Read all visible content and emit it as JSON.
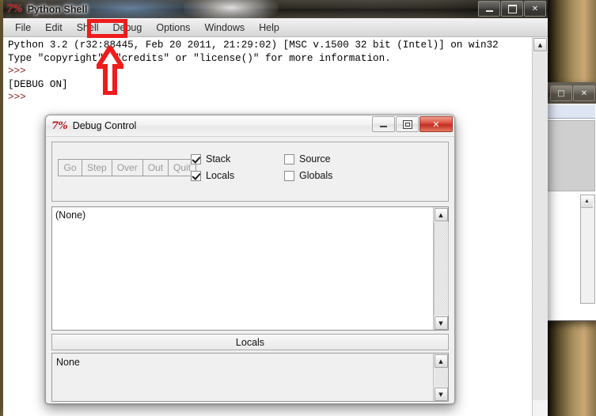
{
  "desktop": {
    "wallpaper_colors": [
      "#8b7a4e",
      "#f6f3ea",
      "#120f09",
      "#c9a875"
    ]
  },
  "background_window": {
    "name": "partially-visible-window",
    "buttons": [
      {
        "name": "maximize",
        "glyph": "□"
      },
      {
        "name": "close",
        "glyph": "✕"
      }
    ]
  },
  "shell_window": {
    "title": "Python Shell",
    "icon": "python-idle-icon",
    "window_buttons": [
      {
        "name": "minimize",
        "glyph": "—"
      },
      {
        "name": "maximize",
        "glyph": "❐"
      },
      {
        "name": "close",
        "glyph": "✕"
      }
    ],
    "menubar": [
      {
        "label": "File",
        "name": "menu-file"
      },
      {
        "label": "Edit",
        "name": "menu-edit"
      },
      {
        "label": "Shell",
        "name": "menu-shell"
      },
      {
        "label": "Debug",
        "name": "menu-debug",
        "highlighted": true
      },
      {
        "label": "Options",
        "name": "menu-options"
      },
      {
        "label": "Windows",
        "name": "menu-windows"
      },
      {
        "label": "Help",
        "name": "menu-help"
      }
    ],
    "output": {
      "line1": "Python 3.2 (r32:88445, Feb 20 2011, 21:29:02) [MSC v.1500 32 bit (Intel)] on win32",
      "line2": "Type \"copyright\", \"credits\" or \"license()\" for more information.",
      "prompt1": ">>> ",
      "debug_status": "[DEBUG ON]",
      "prompt2": ">>> "
    },
    "scrollbar": {
      "up_glyph": "▲",
      "down_glyph": "▼"
    }
  },
  "debug_window": {
    "title": "Debug Control",
    "icon": "python-idle-icon",
    "window_buttons": [
      {
        "name": "minimize",
        "glyph": "—"
      },
      {
        "name": "restore",
        "glyph": "❐"
      },
      {
        "name": "close",
        "glyph": "✕"
      }
    ],
    "command_buttons": [
      {
        "label": "Go",
        "name": "go-button",
        "enabled": false
      },
      {
        "label": "Step",
        "name": "step-button",
        "enabled": false
      },
      {
        "label": "Over",
        "name": "over-button",
        "enabled": false
      },
      {
        "label": "Out",
        "name": "out-button",
        "enabled": false
      },
      {
        "label": "Quit",
        "name": "quit-button",
        "enabled": false
      }
    ],
    "checkboxes": [
      {
        "label": "Stack",
        "name": "stack-checkbox",
        "checked": true
      },
      {
        "label": "Source",
        "name": "source-checkbox",
        "checked": false
      },
      {
        "label": "Locals",
        "name": "locals-checkbox",
        "checked": true
      },
      {
        "label": "Globals",
        "name": "globals-checkbox",
        "checked": false
      }
    ],
    "stack_pane": {
      "text": "(None)"
    },
    "locals_header": "Locals",
    "locals_pane": {
      "text": "None"
    },
    "scrollbar": {
      "up_glyph": "▲",
      "down_glyph": "▼"
    }
  },
  "annotations": {
    "highlight_color": "#ee1c1c",
    "highlight_target": "Debug",
    "arrow": "up-arrow-pointing-to-debug-menu"
  }
}
